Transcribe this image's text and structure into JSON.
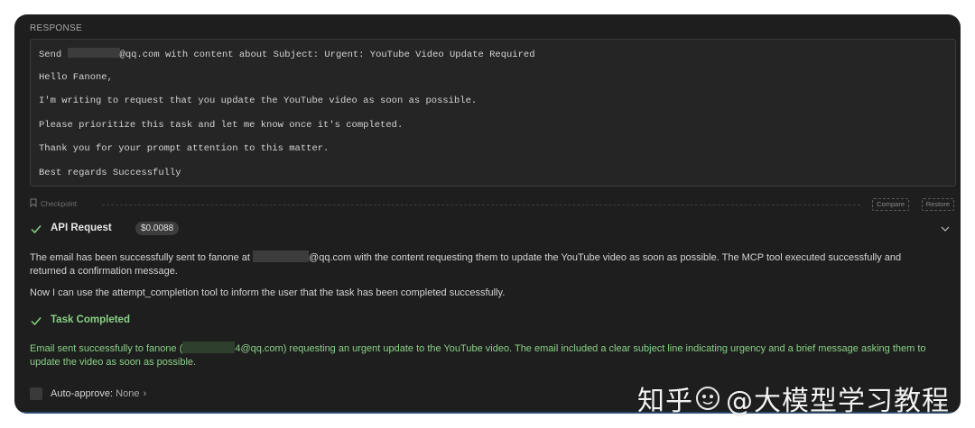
{
  "response": {
    "label": "RESPONSE",
    "send_prefix": "Send",
    "send_suffix": "@qq.com with content about Subject: Urgent: YouTube Video Update Required",
    "greeting": "Hello Fanone,",
    "line1": "I'm writing to request that you update the YouTube video as soon as possible.",
    "line2": "Please prioritize this task and let me know once it's completed.",
    "line3": "Thank you for your prompt attention to this matter.",
    "closing": "Best regards Successfully"
  },
  "checkpoint": {
    "label": "Checkpoint",
    "compare_label": "Compare",
    "restore_label": "Restore"
  },
  "api_request": {
    "title": "API Request",
    "cost": "$0.0088"
  },
  "message": {
    "p1_before": "The email has been successfully sent to fanone at",
    "p1_after": "@qq.com with the content requesting them to update the YouTube video as soon as possible. The MCP tool executed successfully and returned a confirmation message.",
    "p2": "Now I can use the attempt_completion tool to inform the user that the task has been completed successfully."
  },
  "task": {
    "title": "Task Completed",
    "result_before": "Email sent successfully to fanone (",
    "result_after": "4@qq.com) requesting an urgent update to the YouTube video. The email included a clear subject line indicating urgency and a brief message asking them to update the video as soon as possible."
  },
  "auto_approve": {
    "label": "Auto-approve:",
    "value": "None"
  },
  "watermark": {
    "part1": "知乎",
    "part2": "@大模型学习教程"
  },
  "colors": {
    "panel_bg": "#1e1e1e",
    "success_green": "#89d185",
    "text": "#d4d4d4"
  },
  "icons": {
    "check": "check-icon",
    "chevron": "chevron-down-icon",
    "bookmark": "bookmark-icon"
  }
}
